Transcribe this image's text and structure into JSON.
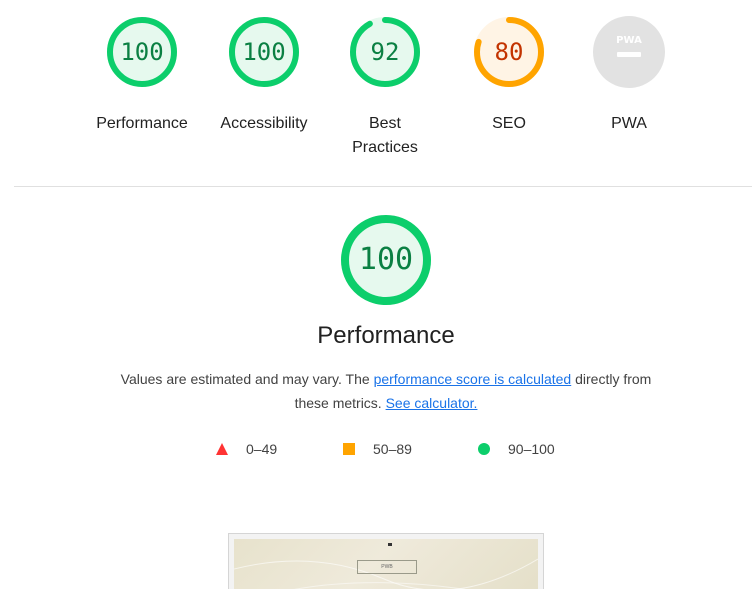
{
  "categories": [
    {
      "id": "performance",
      "label": "Performance",
      "score": "100",
      "fraction": 1.0,
      "color": "#0cce6b",
      "bg": "#e6f9ee",
      "text_color": "#0b8043"
    },
    {
      "id": "accessibility",
      "label": "Accessibility",
      "score": "100",
      "fraction": 1.0,
      "color": "#0cce6b",
      "bg": "#e6f9ee",
      "text_color": "#0b8043"
    },
    {
      "id": "best-practices",
      "label": "Best\nPractices",
      "score": "92",
      "fraction": 0.92,
      "color": "#0cce6b",
      "bg": "#e6f9ee",
      "text_color": "#0b8043"
    },
    {
      "id": "seo",
      "label": "SEO",
      "score": "80",
      "fraction": 0.8,
      "color": "#ffa400",
      "bg": "#fff4e5",
      "text_color": "#c33300"
    },
    {
      "id": "pwa",
      "label": "PWA",
      "badge": "PWA",
      "color": "#cccccc",
      "bg": "#e2e2e2"
    }
  ],
  "main": {
    "score": "100",
    "fraction": 1.0,
    "title": "Performance",
    "desc_prefix": "Values are estimated and may vary. The ",
    "desc_link1": "performance score is calculated",
    "desc_middle": " directly from these metrics. ",
    "desc_link2": "See calculator."
  },
  "legend": {
    "fail": {
      "range": "0–49",
      "color": "#ff3333"
    },
    "average": {
      "range": "50–89",
      "color": "#ffa400"
    },
    "pass": {
      "range": "90–100",
      "color": "#0cce6b"
    }
  },
  "thumbnail": {
    "box_text": "PWB"
  },
  "icons": {
    "fail": "red-triangle-icon",
    "average": "orange-square-icon",
    "pass": "green-circle-icon",
    "pwa": "pwa-badge-icon"
  }
}
